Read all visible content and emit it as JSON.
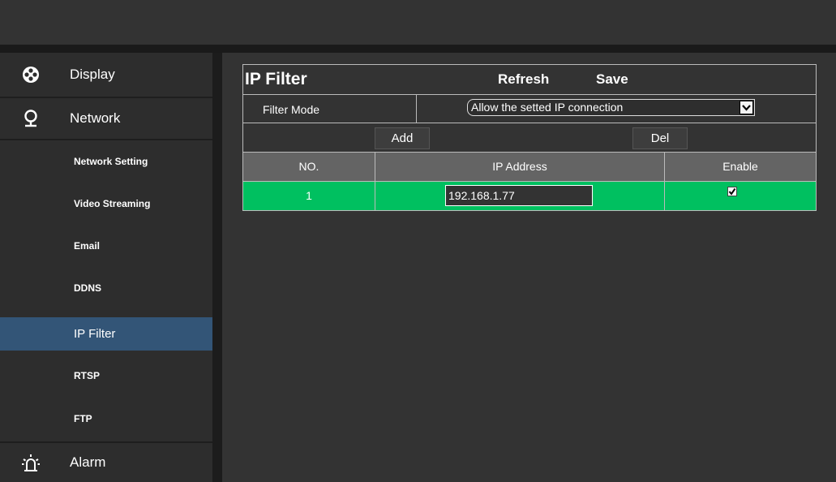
{
  "sidebar": {
    "categories": {
      "display": {
        "label": "Display"
      },
      "network": {
        "label": "Network"
      },
      "alarm": {
        "label": "Alarm"
      }
    },
    "network_items": [
      {
        "label": "Network Setting"
      },
      {
        "label": "Video Streaming"
      },
      {
        "label": "Email"
      },
      {
        "label": "DDNS"
      },
      {
        "label": "IP Filter"
      },
      {
        "label": "RTSP"
      },
      {
        "label": "FTP"
      }
    ],
    "active_item": "IP Filter"
  },
  "panel": {
    "title": "IP Filter",
    "refresh_label": "Refresh",
    "save_label": "Save",
    "filter_mode_label": "Filter Mode",
    "filter_mode_value": "Allow the setted IP connection",
    "add_label": "Add",
    "del_label": "Del",
    "columns": [
      "NO.",
      "IP Address",
      "Enable"
    ],
    "rows": [
      {
        "no": "1",
        "ip": "192.168.1.77",
        "enabled": true
      }
    ]
  },
  "colors": {
    "active_item_bg": "#335577",
    "row_bg": "#00c060",
    "header_bg": "#646464"
  }
}
